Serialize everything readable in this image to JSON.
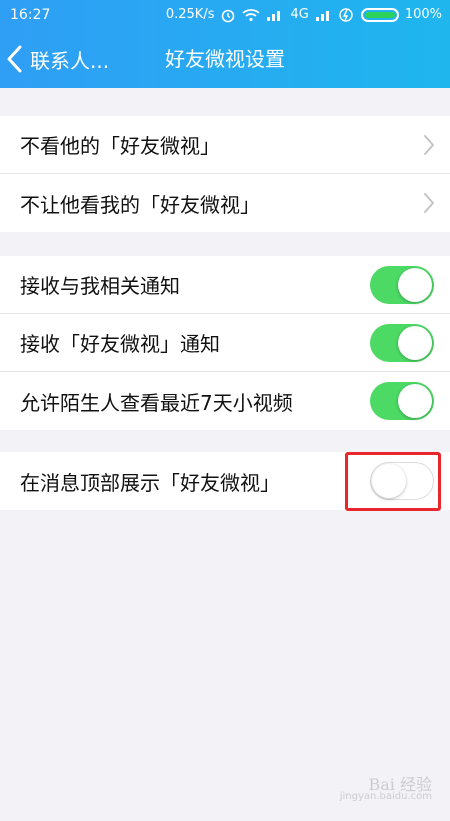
{
  "status_bar": {
    "time": "16:27",
    "speed": "0.25K/s",
    "network": "4G",
    "battery": "100%"
  },
  "nav": {
    "back_label": "联系人...",
    "title": "好友微视设置"
  },
  "groups": [
    {
      "rows": [
        {
          "label": "不看他的「好友微视」",
          "accessory": "chevron-right-icon"
        },
        {
          "label": "不让他看我的「好友微视」",
          "accessory": "chevron-right-icon"
        }
      ]
    },
    {
      "rows": [
        {
          "label": "接收与我相关通知",
          "toggle": true
        },
        {
          "label": "接收「好友微视」通知",
          "toggle": true
        },
        {
          "label": "允许陌生人查看最近7天小视频",
          "toggle": true
        }
      ]
    },
    {
      "rows": [
        {
          "label": "在消息顶部展示「好友微视」",
          "toggle": false
        }
      ]
    }
  ],
  "colors": {
    "header_gradient_start": "#2f9ef5",
    "header_gradient_end": "#1fb6ee",
    "toggle_on": "#4cd964",
    "highlight": "#e8262b",
    "background": "#f2f2f7"
  },
  "watermark": {
    "main": "Bai 经验",
    "sub": "jingyan.baidu.com"
  }
}
